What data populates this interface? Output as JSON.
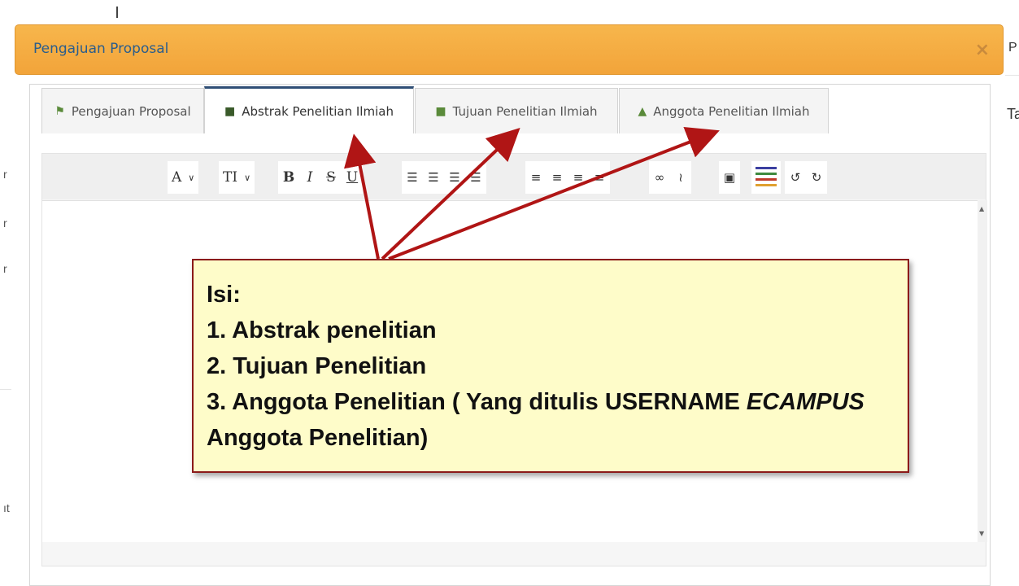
{
  "background": {
    "right_fragment_top": "P",
    "right_fragment_mid": "Ta",
    "left_fragments": [
      "r",
      "r",
      "r",
      "ıt"
    ]
  },
  "modal": {
    "title": "Pengajuan Proposal",
    "close": "×"
  },
  "tabs": [
    {
      "label": "Pengajuan Proposal",
      "icon": "bullhorn-icon",
      "active": false
    },
    {
      "label": "Abstrak Penelitian Ilmiah",
      "icon": "book-icon",
      "active": true
    },
    {
      "label": "Tujuan Penelitian Ilmiah",
      "icon": "book-icon",
      "active": false
    },
    {
      "label": "Anggota Penelitian Ilmiah",
      "icon": "user-icon",
      "active": false
    }
  ],
  "toolbar": {
    "font": "A",
    "font_size": "TI",
    "bold": "B",
    "italic": "I",
    "strike": "S",
    "underline": "U",
    "redo": "C",
    "undo": "C"
  },
  "callout": {
    "heading": "Isi:",
    "items": [
      "1. Abstrak penelitian",
      "2. Tujuan Penelitian",
      "3. Anggota Penelitian ( Yang ditulis USERNAME ",
      "ECAMPUS",
      "Anggota Penelitian)"
    ]
  },
  "colors": {
    "header": "#f2a43a",
    "title": "#2a5d8c",
    "callout_bg": "#fefcc9",
    "callout_border": "#8b1a1a",
    "arrow": "#b01515"
  }
}
